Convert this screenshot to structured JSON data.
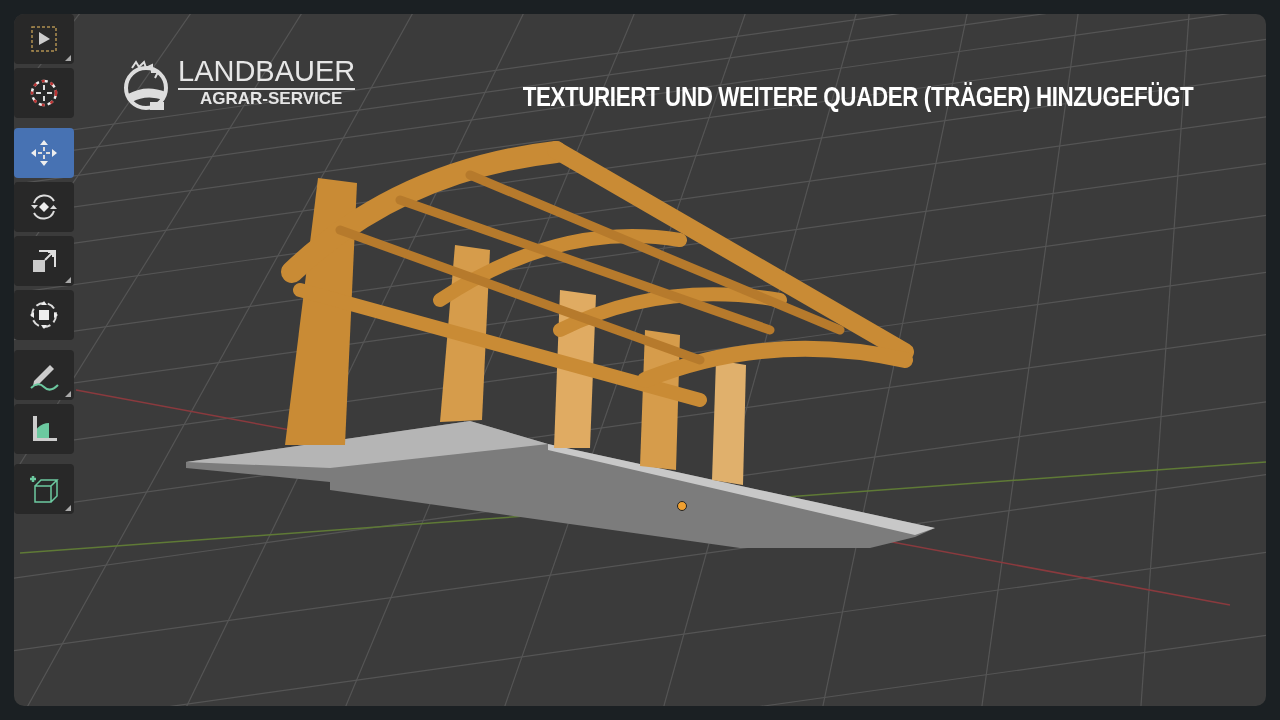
{
  "toolbar": {
    "tools": [
      {
        "kind": "select-box",
        "selected": false,
        "submenu": true
      },
      {
        "kind": "cursor",
        "selected": false,
        "submenu": false
      },
      {
        "kind": "move",
        "selected": true,
        "submenu": false
      },
      {
        "kind": "rotate",
        "selected": false,
        "submenu": false
      },
      {
        "kind": "scale",
        "selected": false,
        "submenu": true
      },
      {
        "kind": "transform",
        "selected": false,
        "submenu": false
      },
      {
        "kind": "annotate",
        "selected": false,
        "submenu": true
      },
      {
        "kind": "measure",
        "selected": false,
        "submenu": false
      },
      {
        "kind": "add-cube",
        "selected": false,
        "submenu": true
      }
    ]
  },
  "logo": {
    "name": "LANDBAUER",
    "subtitle": "AGRAR-SERVICE"
  },
  "caption": "TEXTURIERT UND WEITERE QUADER (TRÄGER) HINZUGEFÜGT"
}
